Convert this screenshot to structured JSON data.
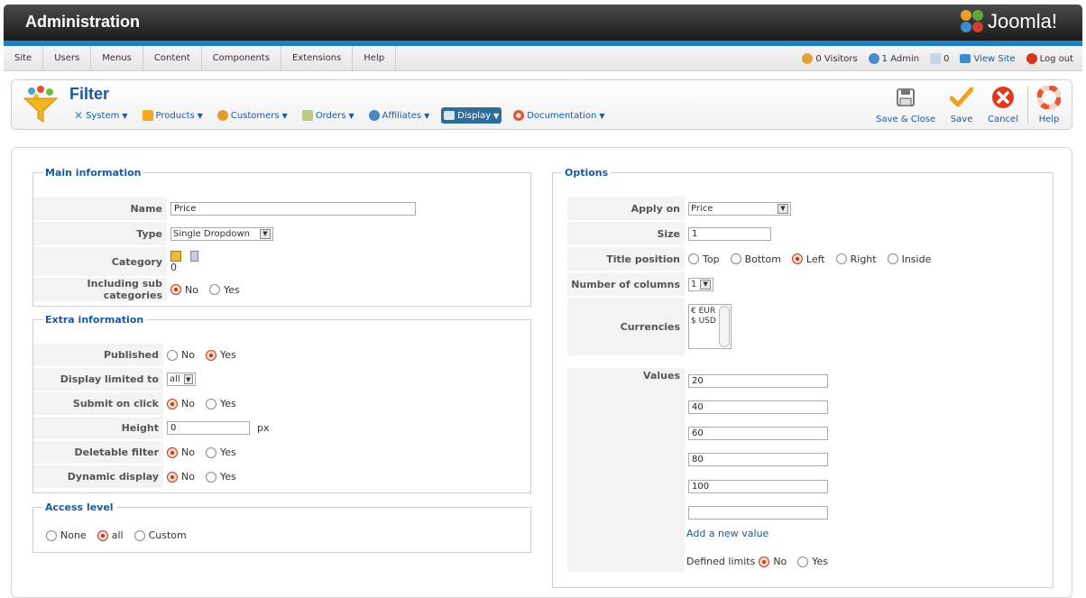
{
  "header": {
    "title": "Administration",
    "logo_text": "Joomla!"
  },
  "menu": {
    "items": [
      "Site",
      "Users",
      "Menus",
      "Content",
      "Components",
      "Extensions",
      "Help"
    ]
  },
  "status": {
    "visitors": "0 Visitors",
    "admin": "1 Admin",
    "messages": "0",
    "view_site": "View Site",
    "logout": "Log out"
  },
  "toolbar": {
    "title": "Filter",
    "submenu": [
      {
        "label": "System",
        "icon": "tools-icon"
      },
      {
        "label": "Products",
        "icon": "products-icon"
      },
      {
        "label": "Customers",
        "icon": "customers-icon"
      },
      {
        "label": "Orders",
        "icon": "orders-icon"
      },
      {
        "label": "Affiliates",
        "icon": "affiliates-icon"
      },
      {
        "label": "Display",
        "icon": "display-icon",
        "active": true
      },
      {
        "label": "Documentation",
        "icon": "help-lifebuoy-icon"
      }
    ],
    "buttons": {
      "save_close": "Save & Close",
      "save": "Save",
      "cancel": "Cancel",
      "help": "Help"
    }
  },
  "main_info": {
    "legend": "Main information",
    "name_label": "Name",
    "name_value": "Price",
    "type_label": "Type",
    "type_value": "Single Dropdown",
    "category_label": "Category",
    "category_value": "0",
    "subcat_label": "Including sub categories",
    "no": "No",
    "yes": "Yes",
    "subcat_selected": "No"
  },
  "extra_info": {
    "legend": "Extra information",
    "published_label": "Published",
    "published_selected": "Yes",
    "display_limited_label": "Display limited to",
    "display_limited_value": "all",
    "submit_label": "Submit on click",
    "submit_selected": "No",
    "height_label": "Height",
    "height_value": "0",
    "height_unit": "px",
    "deletable_label": "Deletable filter",
    "deletable_selected": "No",
    "dynamic_label": "Dynamic display",
    "dynamic_selected": "No",
    "no": "No",
    "yes": "Yes"
  },
  "access": {
    "legend": "Access level",
    "none": "None",
    "all": "all",
    "custom": "Custom",
    "selected": "all"
  },
  "options": {
    "legend": "Options",
    "apply_label": "Apply on",
    "apply_value": "Price",
    "size_label": "Size",
    "size_value": "1",
    "title_pos_label": "Title position",
    "title_pos_options": [
      "Top",
      "Bottom",
      "Left",
      "Right",
      "Inside"
    ],
    "title_pos_selected": "Left",
    "columns_label": "Number of columns",
    "columns_value": "1",
    "currencies_label": "Currencies",
    "currencies": [
      "€ EUR",
      "$ USD"
    ],
    "values_label": "Values",
    "values": [
      "20",
      "40",
      "60",
      "80",
      "100",
      ""
    ],
    "add_value": "Add a new value",
    "defined_limits": "Defined limits",
    "defined_selected": "No",
    "no": "No",
    "yes": "Yes"
  }
}
